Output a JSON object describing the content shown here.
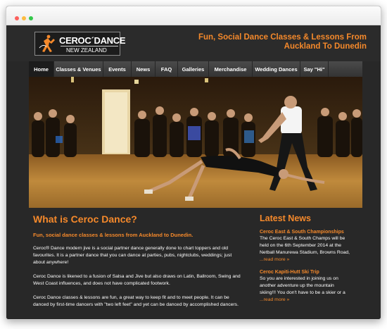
{
  "header": {
    "logo_word": "CEROC´DANCE",
    "logo_sub": "NEW ZEALAND",
    "tagline_1": "Fun, Social Dance Classes & Lessons From",
    "tagline_2": "Auckland To Dunedin"
  },
  "nav": {
    "items": [
      {
        "label": "Home"
      },
      {
        "label": "Classes & Venues"
      },
      {
        "label": "Events"
      },
      {
        "label": "News"
      },
      {
        "label": "FAQ"
      },
      {
        "label": "Galleries"
      },
      {
        "label": "Merchandise"
      },
      {
        "label": "Wedding Dances"
      },
      {
        "label": "Say \"Hi\""
      }
    ]
  },
  "main": {
    "title": "What is Ceroc Dance?",
    "subtitle": "Fun, social dance classes & lessons from Auckland to Dunedin.",
    "paragraphs": [
      "Ceroc® Dance modern jive is a social partner dance generally done to chart toppers and old favourites. It is a partner dance that you can dance at parties, pubs, nightclubs, weddings; just about anywhere!",
      "Ceroc Dance is likened to a  fusion of Salsa and Jive but also draws on Latin, Ballroom, Swing and West Coast influences, and does not have complicated footwork.",
      "Ceroc Dance classes & lessons are fun, a great way to keep fit and to meet people. It can be danced by first-time dancers with \"two left feet\" and yet can be danced by accomplished dancers."
    ]
  },
  "news": {
    "title": "Latest News",
    "items": [
      {
        "heading": "Ceroc East & South Championships",
        "text": "The Ceroc East & South Champs will be held on the 6th September 2014 at the Netball Manurewa Stadium, Browns Road, ",
        "more": "...read more »"
      },
      {
        "heading": "Ceroc Kapiti-Hutt Ski Trip",
        "text": "So you are interested in joining us on another adventure up the mountain skiing!!! You don't have to be a skier or a ",
        "more": "...read more »"
      }
    ]
  },
  "colors": {
    "accent": "#f5892b",
    "background": "#282828",
    "nav": "#3f3f3f",
    "nav_active": "#1c1c1c"
  }
}
